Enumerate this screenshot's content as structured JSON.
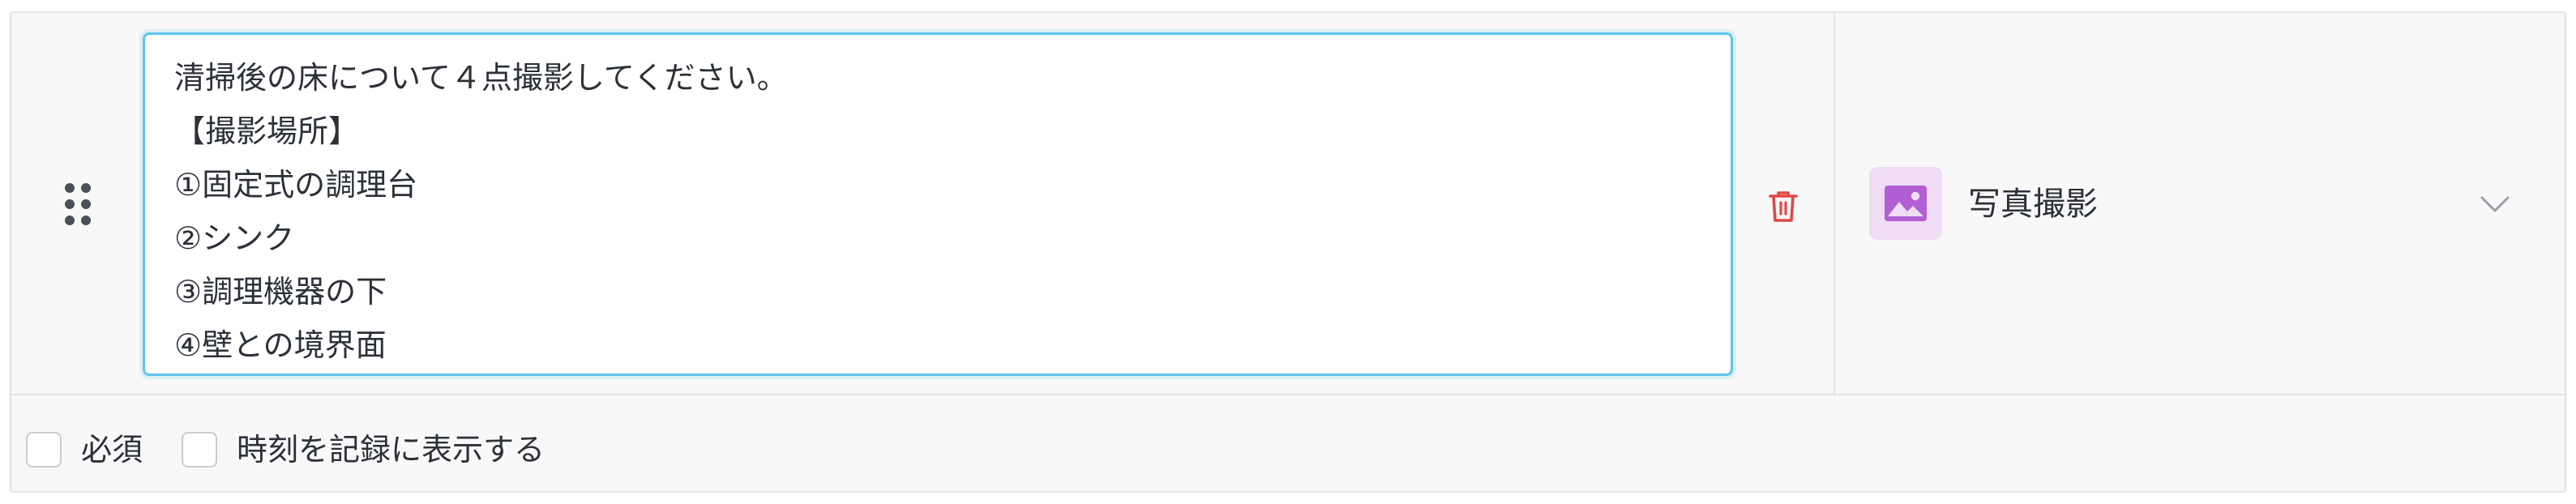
{
  "item": {
    "prompt_text": "清掃後の床について４点撮影してください。\n【撮影場所】\n①固定式の調理台\n②シンク\n③調理機器の下\n④壁との境界面",
    "type_label": "写真撮影",
    "type_icon": "image-icon",
    "type_icon_color": "#b25fd3",
    "type_icon_bg": "#f0dcf5",
    "delete_icon_color": "#e04848"
  },
  "options": {
    "required_label": "必須",
    "record_time_label": "時刻を記録に表示する"
  }
}
